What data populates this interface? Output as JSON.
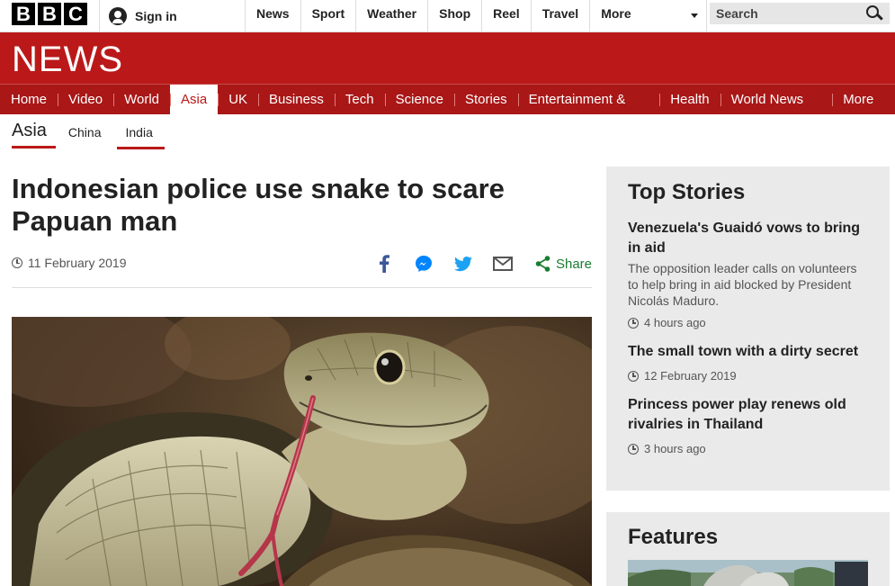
{
  "topbar": {
    "logo_letters": [
      "B",
      "B",
      "C"
    ],
    "signin_label": "Sign in",
    "nav": [
      "News",
      "Sport",
      "Weather",
      "Shop",
      "Reel",
      "Travel"
    ],
    "more_label": "More",
    "search_placeholder": "Search"
  },
  "brand": {
    "wordmark": "NEWS",
    "color": "#bb1919"
  },
  "section_nav": {
    "items": [
      "Home",
      "Video",
      "World",
      "Asia",
      "UK",
      "Business",
      "Tech",
      "Science",
      "Stories",
      "Entertainment & Arts",
      "Health",
      "World News TV"
    ],
    "active": "Asia",
    "more_label": "More"
  },
  "subnav": {
    "current": "Asia",
    "items": [
      "China",
      "India"
    ]
  },
  "article": {
    "headline": "Indonesian police use snake to scare Papuan man",
    "date": "11 February 2019",
    "share_icons": [
      "facebook-icon",
      "messenger-icon",
      "twitter-icon",
      "email-icon"
    ],
    "share_label": "Share",
    "image_alt": "snake-photo"
  },
  "top_stories": {
    "title": "Top Stories",
    "items": [
      {
        "title": "Venezuela's Guaidó vows to bring in aid",
        "summary": "The opposition leader calls on volunteers to help bring in aid blocked by President Nicolás Maduro.",
        "time": "4 hours ago"
      },
      {
        "title": "The small town with a dirty secret",
        "summary": "",
        "time": "12 February 2019"
      },
      {
        "title": "Princess power play renews old rivalries in Thailand",
        "summary": "",
        "time": "3 hours ago"
      }
    ]
  },
  "features": {
    "title": "Features"
  }
}
